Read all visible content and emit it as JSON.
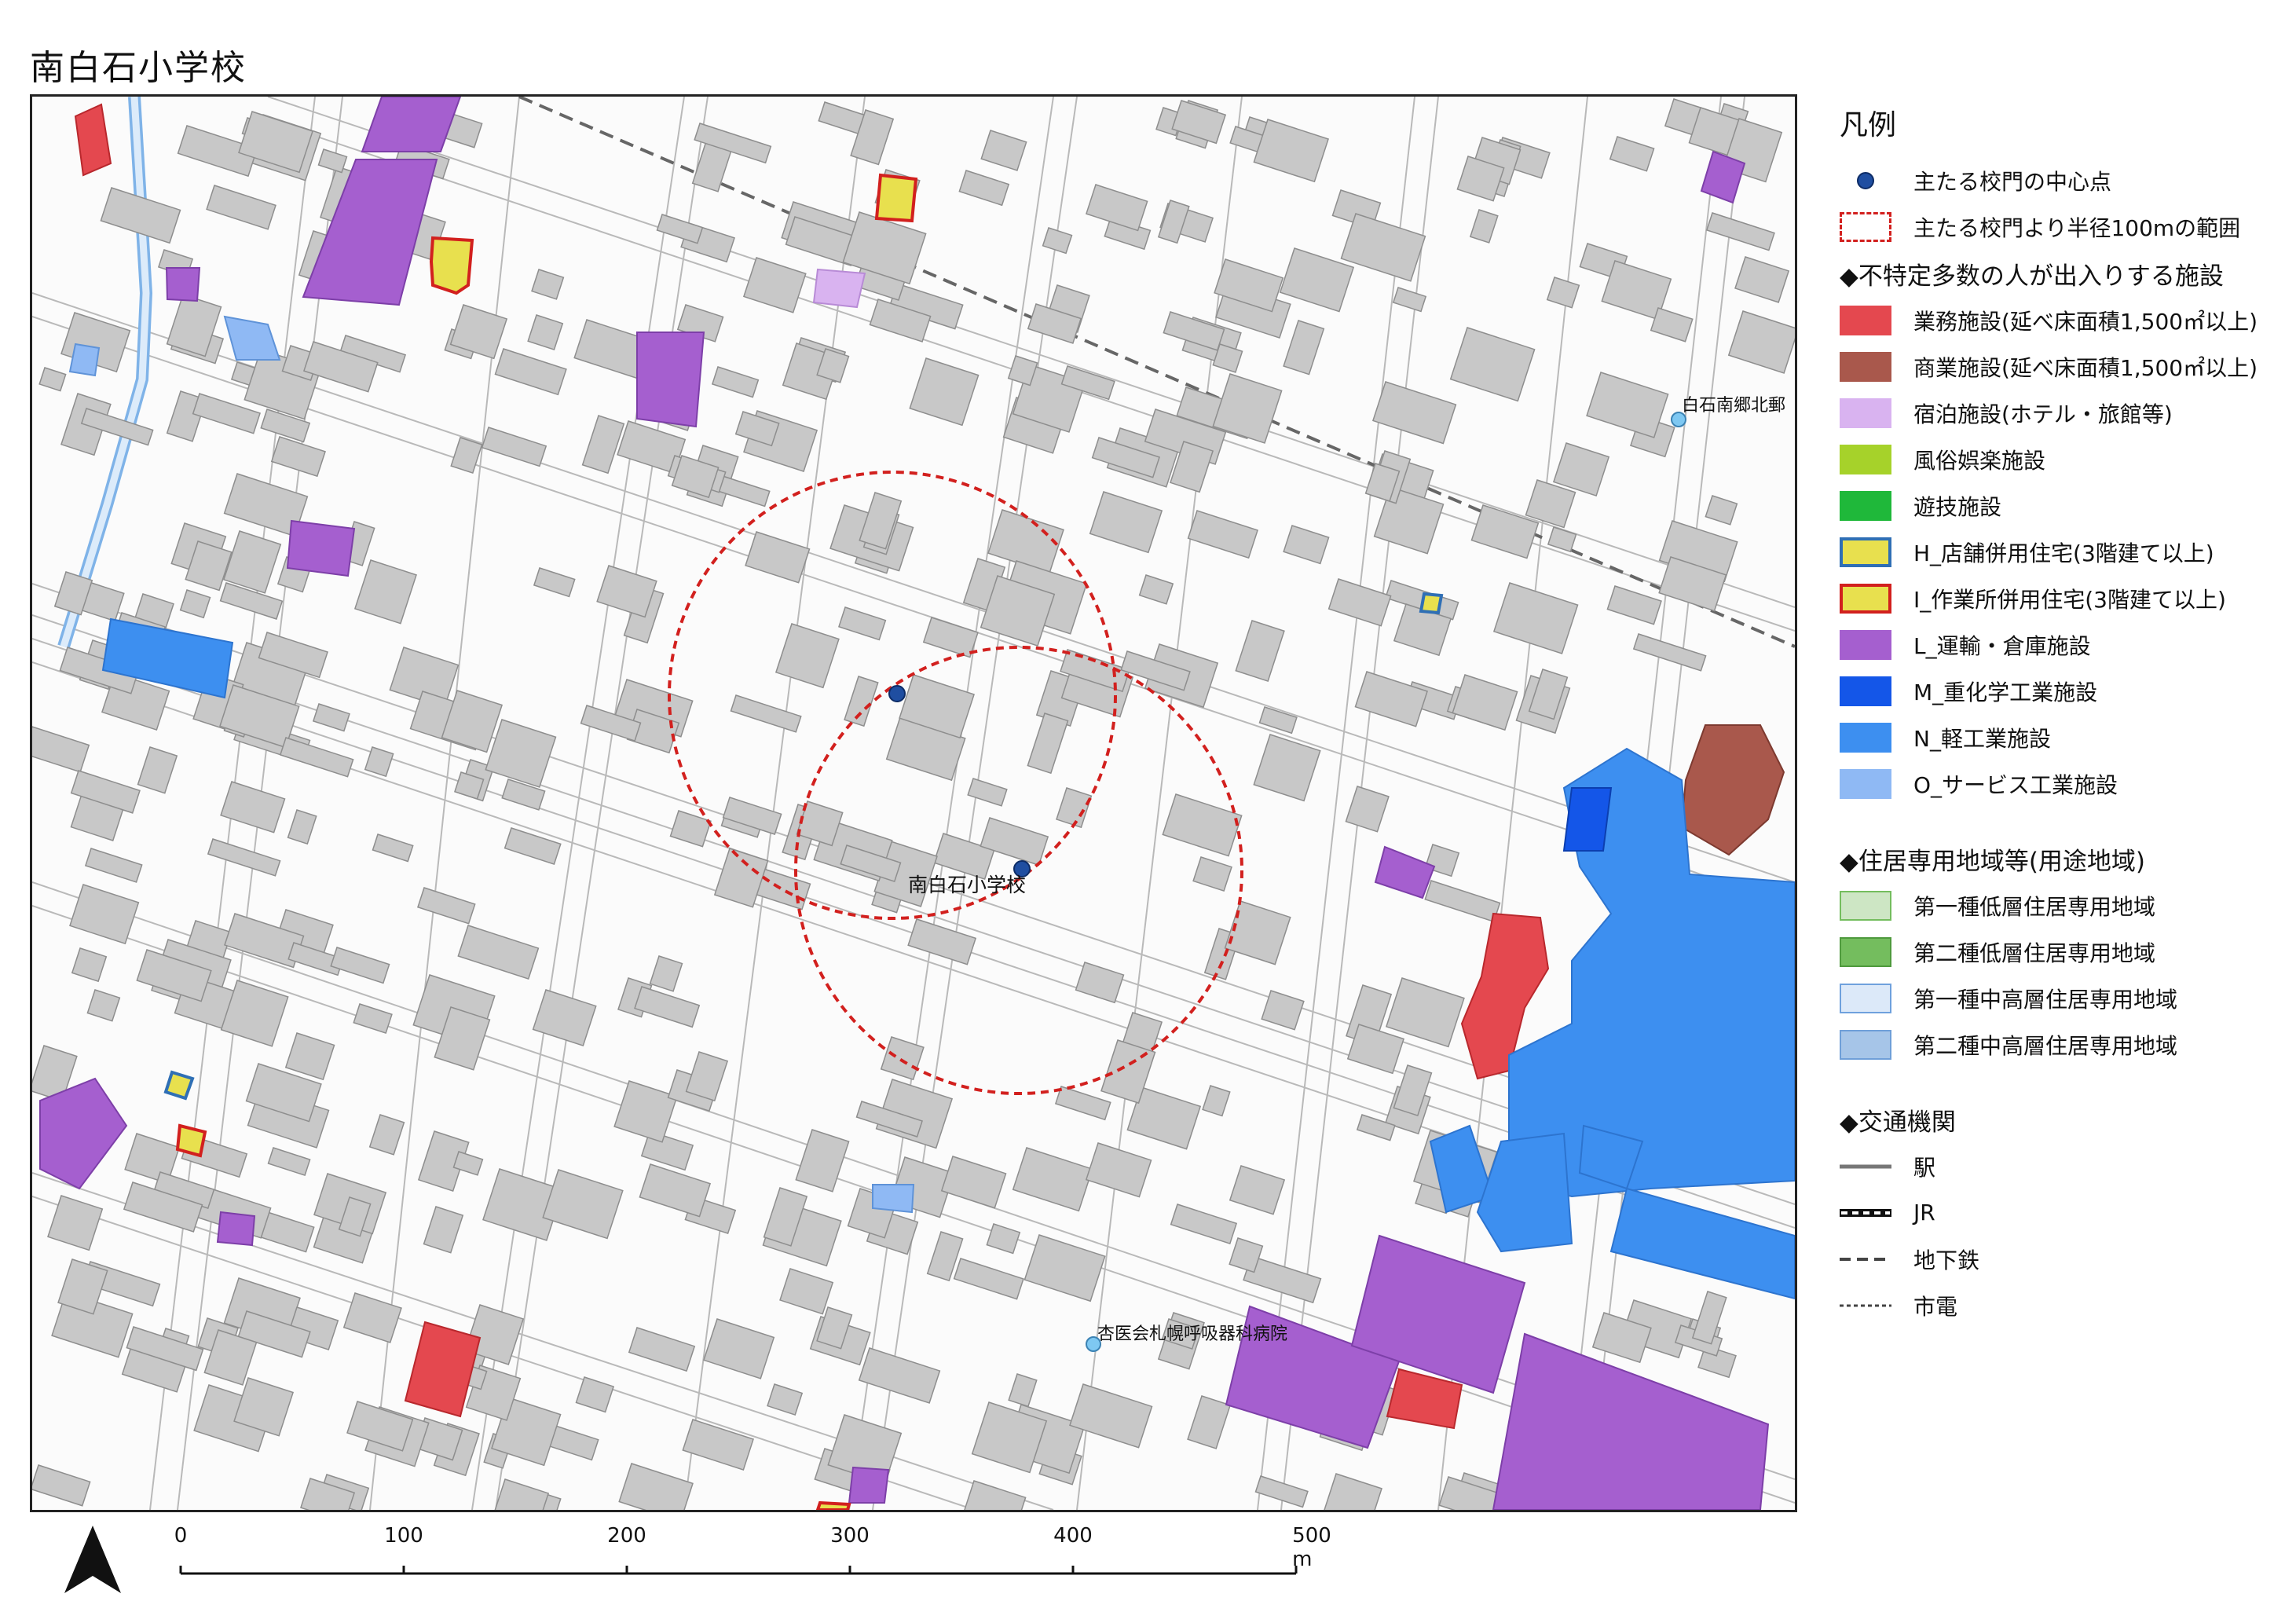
{
  "title": "南白石小学校",
  "map": {
    "school_label": "南白石小学校",
    "hospital_label": "杏医会札幌呼吸器科病院",
    "post_office_label": "白石南郷北郵",
    "colors": {
      "business": "#e4484f",
      "commercial": "#a9584c",
      "lodging": "#d9b3f0",
      "entertainment": "#a6d22a",
      "amusement": "#1fb83a",
      "shop_residence_fill": "#e8e04e",
      "shop_residence_border": "#2f6fb5",
      "workshop_residence_fill": "#e8e04e",
      "workshop_residence_border": "#d2201e",
      "transport_warehouse": "#a55fcf",
      "heavy_chemical": "#1456e8",
      "light_industry": "#3d8ff0",
      "service_industry": "#8fb9f4",
      "residential_low_1": "#cde6c4",
      "residential_low_2": "#74bd5e",
      "residential_mid_1": "#dce9f9",
      "residential_mid_2": "#a6c5e8",
      "building": "#c8c8c8",
      "building_edge": "#8e8e8e",
      "road_edge": "#b8b8b8",
      "radius": "#d2201e",
      "gate": "#1f4ea1"
    }
  },
  "legend": {
    "title": "凡例",
    "gate_center": "主たる校門の中心点",
    "radius_range": "主たる校門より半径100mの範囲",
    "section_facilities": "◆不特定多数の人が出入りする施設",
    "business": "業務施設(延べ床面積1,500㎡以上)",
    "commercial": "商業施設(延べ床面積1,500㎡以上)",
    "lodging": "宿泊施設(ホテル・旅館等)",
    "entertainment": "風俗娯楽施設",
    "amusement": "遊技施設",
    "shop_residence": "H_店舗併用住宅(3階建て以上)",
    "workshop_residence": "I_作業所併用住宅(3階建て以上)",
    "transport_warehouse": "L_運輸・倉庫施設",
    "heavy_chemical": "M_重化学工業施設",
    "light_industry": "N_軽工業施設",
    "service_industry": "O_サービス工業施設",
    "section_zones": "◆住居専用地域等(用途地域)",
    "residential_low_1": "第一種低層住居専用地域",
    "residential_low_2": "第二種低層住居専用地域",
    "residential_mid_1": "第一種中高層住居専用地域",
    "residential_mid_2": "第二種中高層住居専用地域",
    "section_transport": "◆交通機関",
    "station": "駅",
    "jr": "JR",
    "subway": "地下鉄",
    "tram": "市電"
  },
  "scale": {
    "ticks": [
      "0",
      "100",
      "200",
      "300",
      "400",
      "500 m"
    ]
  }
}
